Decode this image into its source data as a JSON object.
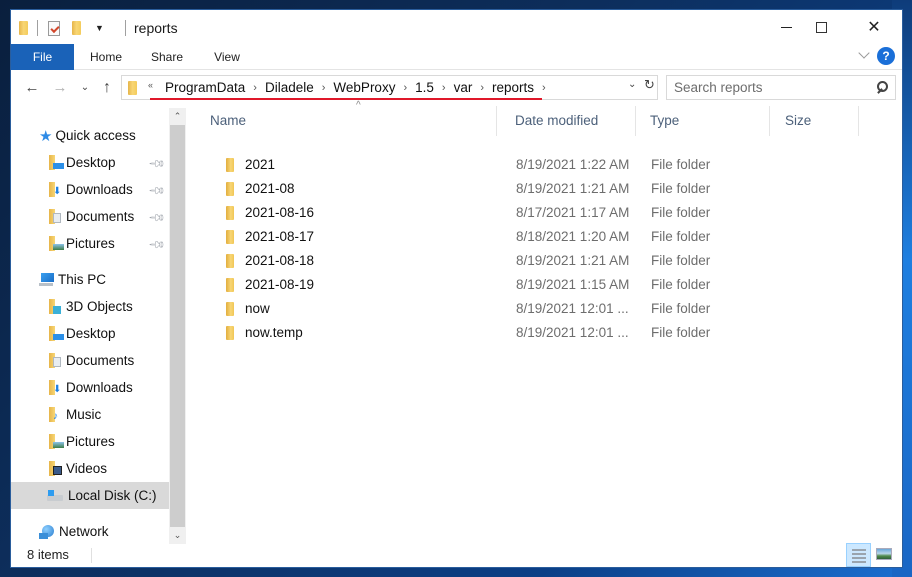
{
  "window": {
    "title": "reports",
    "controls": {
      "minimize": "minimize",
      "maximize": "maximize",
      "close": "close"
    }
  },
  "quick_access_toolbar": {
    "icons": [
      "folder-icon",
      "properties-icon",
      "new-folder-icon",
      "customize-dropdown-icon"
    ]
  },
  "ribbon": {
    "tabs": [
      {
        "label": "File",
        "active": true
      },
      {
        "label": "Home"
      },
      {
        "label": "Share"
      },
      {
        "label": "View"
      }
    ],
    "help_label": "?"
  },
  "navigation": {
    "back": "←",
    "forward": "→",
    "recent": "⌄",
    "up": "↑",
    "overflow": "«",
    "breadcrumbs": [
      "ProgramData",
      "Diladele",
      "WebProxy",
      "1.5",
      "var",
      "reports"
    ],
    "separator": "›",
    "dropdown": "⌄",
    "refresh": "↻",
    "highlight_color": "#e0182a"
  },
  "search": {
    "placeholder": "Search reports"
  },
  "sidebar": {
    "items": [
      {
        "label": "Quick access",
        "icon": "star-icon",
        "level": 0
      },
      {
        "label": "Desktop",
        "icon": "desktop-folder-icon",
        "level": 1,
        "pinned": true
      },
      {
        "label": "Downloads",
        "icon": "downloads-folder-icon",
        "level": 1,
        "pinned": true
      },
      {
        "label": "Documents",
        "icon": "documents-folder-icon",
        "level": 1,
        "pinned": true
      },
      {
        "label": "Pictures",
        "icon": "pictures-folder-icon",
        "level": 1,
        "pinned": true
      },
      {
        "label": "This PC",
        "icon": "computer-icon",
        "level": 0
      },
      {
        "label": "3D Objects",
        "icon": "3d-objects-folder-icon",
        "level": 1
      },
      {
        "label": "Desktop",
        "icon": "desktop-folder-icon",
        "level": 1
      },
      {
        "label": "Documents",
        "icon": "documents-folder-icon",
        "level": 1
      },
      {
        "label": "Downloads",
        "icon": "downloads-folder-icon",
        "level": 1
      },
      {
        "label": "Music",
        "icon": "music-folder-icon",
        "level": 1
      },
      {
        "label": "Pictures",
        "icon": "pictures-folder-icon",
        "level": 1
      },
      {
        "label": "Videos",
        "icon": "videos-folder-icon",
        "level": 1
      },
      {
        "label": "Local Disk (C:)",
        "icon": "local-disk-icon",
        "level": 1,
        "selected": true
      },
      {
        "label": "Network",
        "icon": "network-icon",
        "level": 0
      }
    ]
  },
  "file_list": {
    "columns": [
      "Name",
      "Date modified",
      "Type",
      "Size"
    ],
    "sorted_by": "Name",
    "rows": [
      {
        "name": "2021",
        "date": "8/19/2021 1:22 AM",
        "type": "File folder",
        "size": ""
      },
      {
        "name": "2021-08",
        "date": "8/19/2021 1:21 AM",
        "type": "File folder",
        "size": ""
      },
      {
        "name": "2021-08-16",
        "date": "8/17/2021 1:17 AM",
        "type": "File folder",
        "size": ""
      },
      {
        "name": "2021-08-17",
        "date": "8/18/2021 1:20 AM",
        "type": "File folder",
        "size": ""
      },
      {
        "name": "2021-08-18",
        "date": "8/19/2021 1:21 AM",
        "type": "File folder",
        "size": ""
      },
      {
        "name": "2021-08-19",
        "date": "8/19/2021 1:15 AM",
        "type": "File folder",
        "size": ""
      },
      {
        "name": "now",
        "date": "8/19/2021 12:01 ...",
        "type": "File folder",
        "size": ""
      },
      {
        "name": "now.temp",
        "date": "8/19/2021 12:01 ...",
        "type": "File folder",
        "size": ""
      }
    ]
  },
  "status_bar": {
    "item_count": "8 items",
    "view_modes": [
      {
        "name": "details-view",
        "active": true
      },
      {
        "name": "large-icons-view",
        "active": false
      }
    ]
  },
  "colors": {
    "file_tab": "#1a62b8",
    "selected_nav": "#d9d9d9",
    "details_view_active": "#cce8ff"
  }
}
